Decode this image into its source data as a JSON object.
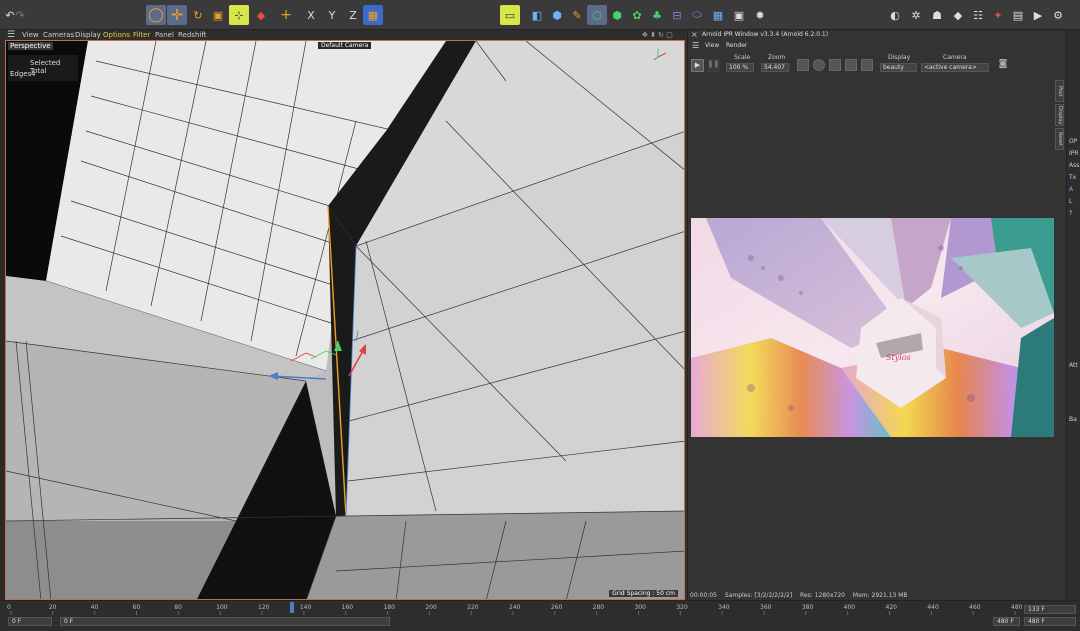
{
  "viewport": {
    "menu": [
      "View",
      "Cameras",
      "Display",
      "Options",
      "Filter",
      "Panel",
      "Redshift"
    ],
    "label": "Perspective",
    "camera": "Default Camera",
    "hud_header": "Selected Total",
    "hud_row_label": "Edges",
    "hud_row_value": "4",
    "grid_spacing": "Grid Spacing : 50 cm"
  },
  "arnold": {
    "title": "Arnold IPR Window v3.3.4 (Arnold 6.2.0.1)",
    "menu": [
      "View",
      "Render"
    ],
    "scale_label": "Scale",
    "scale_value": "100 %",
    "zoom_label": "Zoom",
    "zoom_value": "54.407",
    "display_label": "Display",
    "display_value": "beauty",
    "camera_label": "Camera",
    "camera_value": "<active camera>",
    "status": {
      "time": "00:00:05",
      "samples": "Samples: [3/2/2/2/2/2]",
      "res": "Res: 1280x720",
      "mem": "Mem: 2921.13 MB"
    },
    "side_tabs": [
      "Post",
      "Display",
      "Reset"
    ]
  },
  "right_strip": [
    "OP",
    "IPR",
    "Ass",
    "Tx",
    "A",
    "L",
    "?",
    "Att",
    "Ba"
  ],
  "timeline": {
    "ticks": [
      "0",
      "20",
      "40",
      "60",
      "80",
      "100",
      "120",
      "140",
      "160",
      "180",
      "200",
      "220",
      "240",
      "260",
      "280",
      "300",
      "320",
      "340",
      "360",
      "380",
      "400",
      "420",
      "440",
      "460",
      "480"
    ],
    "current_frame": "133",
    "start_field": "0 F",
    "start_field2": "0 F",
    "end_field": "480 F",
    "end_field2": "480 F",
    "current_field": "133 F"
  }
}
